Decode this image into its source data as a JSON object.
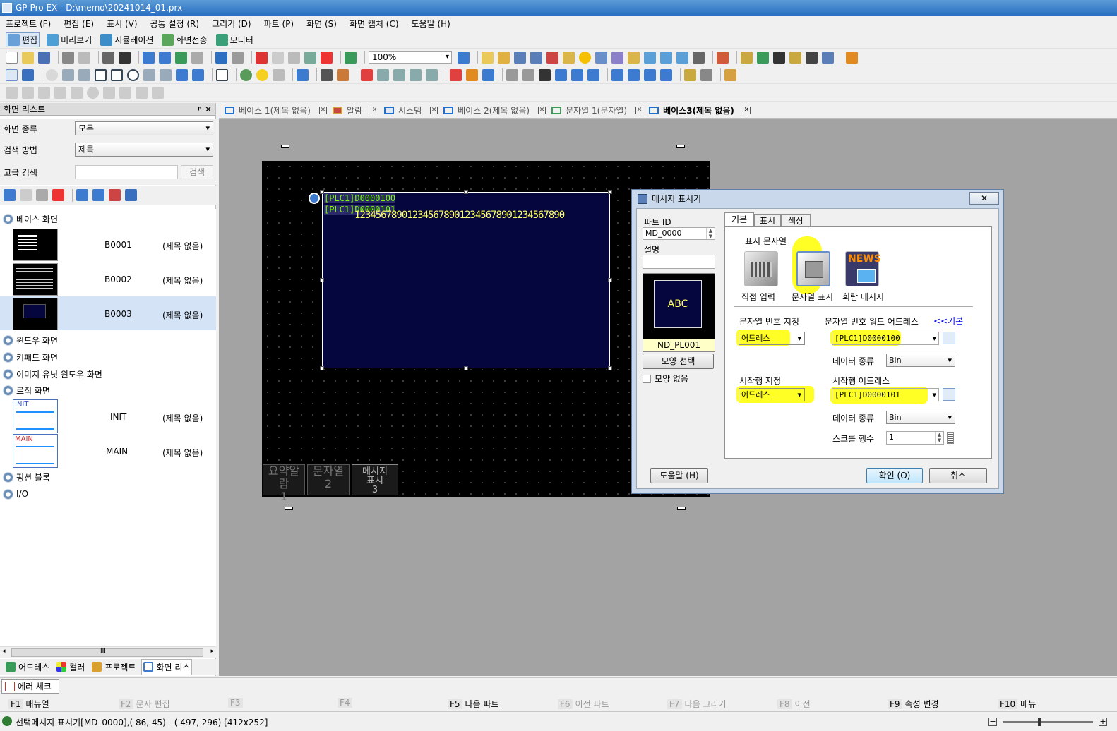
{
  "app": {
    "title": "GP-Pro EX - D:\\memo\\20241014_01.prx"
  },
  "menu": [
    "프로젝트 (F)",
    "편집 (E)",
    "표시 (V)",
    "공통 설정 (R)",
    "그리기 (D)",
    "파트 (P)",
    "화면 (S)",
    "화면 캡처 (C)",
    "도움말 (H)"
  ],
  "modes": [
    "편집",
    "미리보기",
    "시뮬레이션",
    "화면전송",
    "모니터"
  ],
  "toolbar": {
    "zoom": "100%"
  },
  "screen_list": {
    "title": "화면 리스트",
    "pin": "ᵖ ✕",
    "type_label": "화면 종류",
    "type_value": "모두",
    "search_label": "검색 방법",
    "search_value": "제목",
    "adv_label": "고급 검색",
    "adv_button": "검색",
    "groups": {
      "base": "베이스 화면",
      "window": "윈도우 화면",
      "keypad": "키패드 화면",
      "image": "이미지 유닛 윈도우 화면",
      "logic": "로직 화면",
      "func": "펑션 블록",
      "io": "I/O"
    },
    "base_screens": [
      {
        "id": "B0001",
        "title": "(제목 없음)"
      },
      {
        "id": "B0002",
        "title": "(제목 없음)"
      },
      {
        "id": "B0003",
        "title": "(제목 없음)"
      }
    ],
    "logic_screens": [
      {
        "id": "INIT",
        "thumb": "INIT",
        "title": "(제목 없음)"
      },
      {
        "id": "MAIN",
        "thumb": "MAIN",
        "title": "(제목 없음)"
      }
    ],
    "hscroll": "III",
    "bottom_tabs": [
      "어드레스",
      "컬러",
      "프로젝트",
      "화면 리스"
    ]
  },
  "doc_tabs": [
    "베이스 1(제목 없음)",
    "알람",
    "시스템",
    "베이스 2(제목 없음)",
    "문자열 1(문자열)",
    "베이스3(제목 없음)"
  ],
  "canvas": {
    "addr1": "[PLC1]D0000100",
    "addr2": "[PLC1]D0000101",
    "message": "1234567890123456789012345678901234567890",
    "bottom_tabs": [
      {
        "l1": "요약알람",
        "l2": "1"
      },
      {
        "l1": "문자열",
        "l2": "2"
      },
      {
        "l1": "메시지 표시",
        "l2": "3"
      }
    ]
  },
  "dialog": {
    "title": "메시지 표시기",
    "close": "✕",
    "part_id_label": "파트 ID",
    "part_id": "MD_0000",
    "desc_label": "설명",
    "preview_text": "ABC",
    "preview_caption": "ND_PL001",
    "shape_button": "모양 선택",
    "no_shape": "모양 없음",
    "help": "도움말 (H)",
    "ok": "확인 (O)",
    "cancel": "취소",
    "tabs": [
      "기본",
      "표시",
      "색상"
    ],
    "display_string_label": "표시 문자열",
    "opt_direct": "직접 입력",
    "opt_string": "문자열 표시",
    "opt_news": "회람 메시지",
    "news_word": "NEWS",
    "str_num_label": "문자열 번호 지정",
    "str_num_value": "어드레스",
    "word_addr_label": "문자열 번호 워드 어드레스",
    "basic_link": "<<기본",
    "word_addr_value": "[PLC1]D0000100",
    "data_type_label": "데이터 종류",
    "data_type1": "Bin",
    "start_row_label": "시작행 지정",
    "start_row_value": "어드레스",
    "start_addr_label": "시작행 어드레스",
    "start_addr_value": "[PLC1]D0000101",
    "data_type2": "Bin",
    "scroll_label": "스크롤 행수",
    "scroll_value": "1"
  },
  "error_tab": "에러 체크",
  "fkeys": [
    {
      "k": "F1",
      "l": "매뉴얼"
    },
    {
      "k": "F2",
      "l": "문자 편집"
    },
    {
      "k": "F3",
      "l": ""
    },
    {
      "k": "F4",
      "l": ""
    },
    {
      "k": "F5",
      "l": "다음 파트"
    },
    {
      "k": "F6",
      "l": "이전 파트"
    },
    {
      "k": "F7",
      "l": "다음 그리기"
    },
    {
      "k": "F8",
      "l": "이전"
    },
    {
      "k": "F9",
      "l": "속성 변경"
    },
    {
      "k": "F10",
      "l": "메뉴"
    }
  ],
  "status": {
    "text": "선택메시지 표시기[MD_0000],(  86,  45) - ( 497, 296) [412x252]"
  }
}
